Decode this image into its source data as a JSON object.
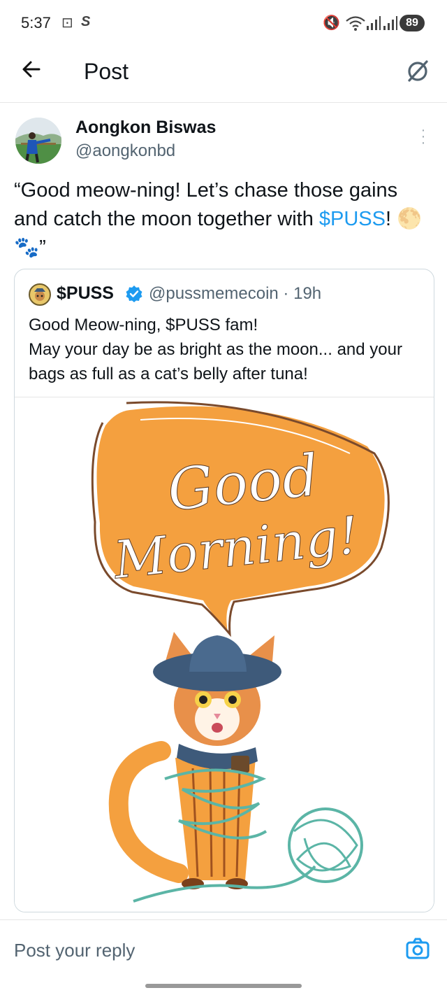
{
  "status_bar": {
    "time": "5:37",
    "battery": "89"
  },
  "header": {
    "title": "Post",
    "back_icon": "arrow-left-icon",
    "grok_icon": "grok-icon"
  },
  "post": {
    "author_name": "Aongkon Biswas",
    "author_handle": "@aongkonbd",
    "text_before_link": "“Good meow-ning! Let’s chase those gains and catch the moon together with ",
    "link_text": "$PUSS",
    "text_after_link": "! 🌕🐾”"
  },
  "quote": {
    "name": "$PUSS",
    "handle": "@pussmemecoin",
    "time": "19h",
    "line1": "Good Meow-ning, $PUSS fam!",
    "line2": "May your day be as bright as the moon... and your bags as full as a cat’s belly after tuna!",
    "image_text_line1": "Good",
    "image_text_line2": "Morning!"
  },
  "reply": {
    "placeholder": "Post your reply"
  },
  "colors": {
    "accent": "#1d9bf0",
    "bubble": "#f4a03f",
    "bubble_outline": "#7a4a2c",
    "yarn": "#5bb5a6",
    "hat": "#3e5a7a"
  }
}
